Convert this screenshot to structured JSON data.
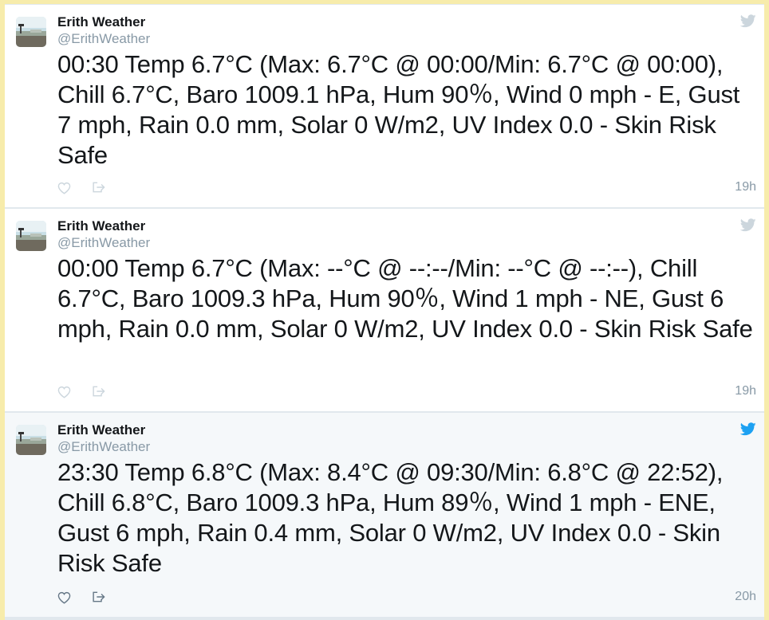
{
  "colors": {
    "page_background": "#f7ecab",
    "tweet_background": "#ffffff",
    "highlighted_tweet_background": "#f5f8fa",
    "bird_icon_muted": "#ccd6dd",
    "bird_icon_active": "#1da1f2",
    "meta_text": "#8899a6"
  },
  "tweets": [
    {
      "author_name": "Erith Weather",
      "handle": "@ErithWeather",
      "text": "00:30 Temp 6.7°C (Max: 6.7°C @ 00:00/Min: 6.7°C @ 00:00), Chill 6.7°C, Baro 1009.1 hPa, Hum 90％, Wind 0 mph - E, Gust 7 mph, Rain 0.0 mm, Solar 0 W/m2, UV Index 0.0 - Skin Risk Safe",
      "time": "19h",
      "icons": [
        "twitter-bird-icon",
        "heart-icon",
        "share-icon"
      ]
    },
    {
      "author_name": "Erith Weather",
      "handle": "@ErithWeather",
      "text": "00:00 Temp 6.7°C (Max: --°C @ --:--/Min: --°C @ --:--), Chill 6.7°C, Baro 1009.3 hPa, Hum 90％, Wind 1 mph - NE, Gust 6 mph, Rain 0.0 mm, Solar 0 W/m2, UV Index 0.0 - Skin Risk Safe",
      "time": "19h",
      "icons": [
        "twitter-bird-icon",
        "heart-icon",
        "share-icon"
      ]
    },
    {
      "author_name": "Erith Weather",
      "handle": "@ErithWeather",
      "text": "23:30 Temp 6.8°C (Max: 8.4°C @ 09:30/Min: 6.8°C @ 22:52), Chill 6.8°C, Baro 1009.3 hPa, Hum 89％, Wind 1 mph - ENE, Gust 6 mph, Rain 0.4 mm, Solar 0 W/m2, UV Index 0.0 - Skin Risk Safe",
      "time": "20h",
      "icons": [
        "twitter-bird-icon",
        "heart-icon",
        "share-icon"
      ]
    }
  ]
}
